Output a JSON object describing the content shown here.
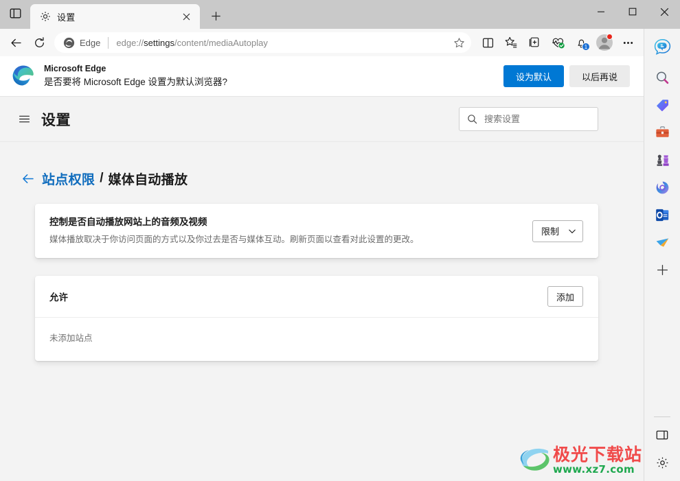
{
  "window": {
    "minimize_label": "—",
    "maximize_label": "□",
    "close_label": "✕"
  },
  "tabstrip": {
    "tab_search_icon": "tab-actions-icon",
    "tabs": [
      {
        "title": "设置",
        "favicon": "gear-icon",
        "close_label": "✕"
      }
    ],
    "new_tab_label": "+"
  },
  "toolbar": {
    "back_label": "←",
    "refresh_label": "⟳",
    "omnibox": {
      "brand": "Edge",
      "url_scheme": "edge://",
      "url_bold": "settings",
      "url_rest": "/content/mediaAutoplay",
      "favorite_icon": "star-outline-icon"
    },
    "buttons": [
      {
        "name": "split-screen-icon"
      },
      {
        "name": "favorites-icon"
      },
      {
        "name": "collections-icon"
      },
      {
        "name": "browser-essentials-icon"
      },
      {
        "name": "notifications-icon",
        "badge": "1"
      },
      {
        "name": "profile-avatar-icon"
      },
      {
        "name": "settings-and-more-icon"
      }
    ]
  },
  "banner": {
    "logo": "edge-logo-icon",
    "title": "Microsoft Edge",
    "message": "是否要将 Microsoft Edge 设置为默认浏览器?",
    "primary_button": "设为默认",
    "secondary_button": "以后再说"
  },
  "settings_header": {
    "menu_icon": "hamburger-icon",
    "title": "设置",
    "search_icon": "search-icon",
    "search_placeholder": "搜索设置",
    "search_value": ""
  },
  "breadcrumb": {
    "back_icon": "back-arrow-icon",
    "parent": "站点权限",
    "separator": "/",
    "current": "媒体自动播放"
  },
  "autoplay_card": {
    "title": "控制是否自动播放网站上的音频及视频",
    "description": "媒体播放取决于你访问页面的方式以及你过去是否与媒体互动。刷新页面以查看对此设置的更改。",
    "dropdown_value": "限制",
    "dropdown_icon": "chevron-down-icon"
  },
  "allow_card": {
    "title": "允许",
    "add_button": "添加",
    "empty_text": "未添加站点"
  },
  "sidebar": {
    "items": [
      {
        "name": "copilot-icon",
        "label": "Copilot"
      },
      {
        "name": "search-icon",
        "label": "搜索"
      },
      {
        "name": "shopping-tag-icon",
        "label": "购物"
      },
      {
        "name": "tools-briefcase-icon",
        "label": "工具"
      },
      {
        "name": "games-chess-icon",
        "label": "游戏"
      },
      {
        "name": "microsoft-365-icon",
        "label": "Microsoft 365"
      },
      {
        "name": "outlook-icon",
        "label": "Outlook"
      },
      {
        "name": "send-plane-icon",
        "label": "发送"
      },
      {
        "name": "add-sidebar-app-icon",
        "label": "+"
      }
    ],
    "bottom_items": [
      {
        "name": "sidebar-toggle-icon",
        "label": "切换边栏"
      },
      {
        "name": "sidebar-settings-gear-icon",
        "label": "设置"
      }
    ]
  },
  "watermark": {
    "title": "极光下载站",
    "url": "www.xz7.com"
  },
  "colors": {
    "accent_blue": "#0078d4",
    "link_blue": "#0f6cbd",
    "page_bg": "#f3f3f3",
    "card_bg": "#ffffff",
    "titlebar_bg": "#c9c9c9",
    "toolbar_bg": "#f7f7f7",
    "watermark_red": "#f04a4a",
    "watermark_green": "#1fa84f"
  }
}
